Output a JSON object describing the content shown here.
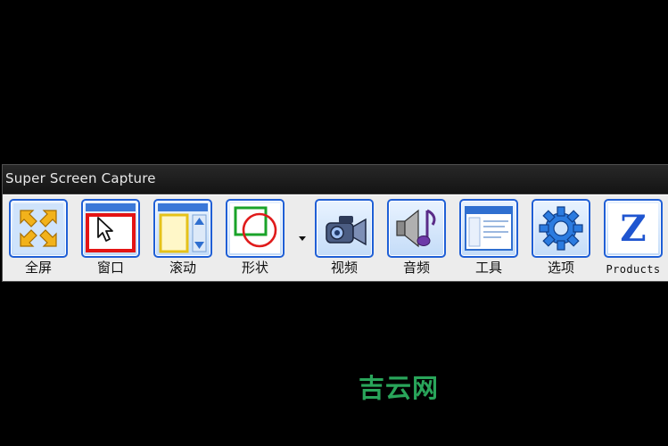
{
  "window": {
    "title": "Super Screen Capture"
  },
  "toolbar": {
    "buttons": [
      {
        "label": "全屏",
        "icon": "fullscreen-arrows-icon"
      },
      {
        "label": "窗口",
        "icon": "window-cursor-icon"
      },
      {
        "label": "滚动",
        "icon": "scroll-window-icon"
      },
      {
        "label": "形状",
        "icon": "shape-select-icon"
      },
      {
        "label": "视频",
        "icon": "video-camera-icon"
      },
      {
        "label": "音频",
        "icon": "speaker-audio-icon"
      },
      {
        "label": "工具",
        "icon": "tool-window-icon"
      },
      {
        "label": "选项",
        "icon": "gear-options-icon"
      },
      {
        "label": "Products",
        "icon": "z-products-icon",
        "glyph": "Z"
      }
    ],
    "shape_dropdown": {
      "icon": "chevron-down-icon"
    }
  },
  "watermark": {
    "text": "吉云网"
  },
  "colors": {
    "accent": "#1f5fd6",
    "background": "#000000",
    "watermark": "#29a55a"
  }
}
